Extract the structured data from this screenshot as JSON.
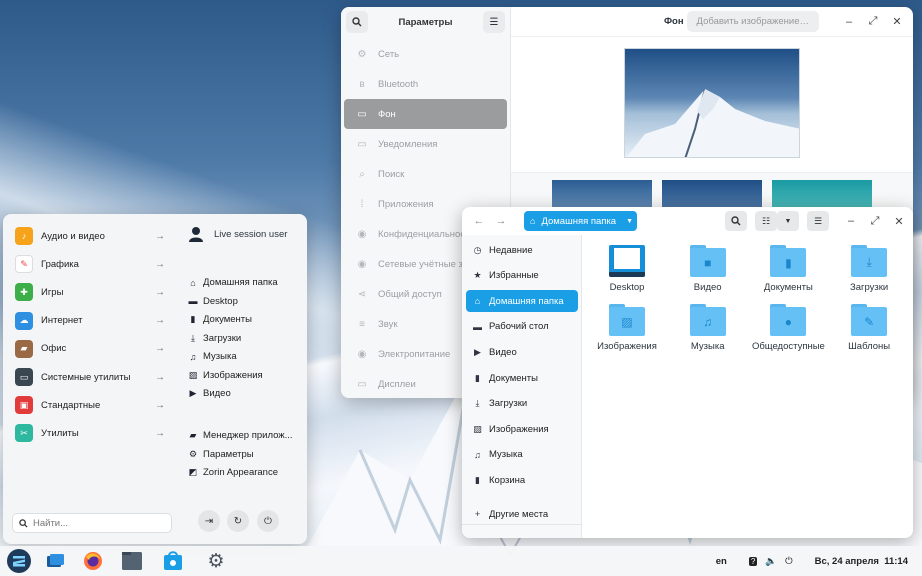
{
  "settings": {
    "title": "Параметры",
    "page_title": "Фон",
    "add_button": "Добавить изображение…",
    "items": [
      {
        "label": "Сеть",
        "icon": "network-icon"
      },
      {
        "label": "Bluetooth",
        "icon": "bluetooth-icon"
      },
      {
        "label": "Фон",
        "icon": "display-icon"
      },
      {
        "label": "Уведомления",
        "icon": "notifications-icon"
      },
      {
        "label": "Поиск",
        "icon": "search-icon"
      },
      {
        "label": "Приложения",
        "icon": "apps-icon"
      },
      {
        "label": "Конфиденциальность",
        "icon": "privacy-icon"
      },
      {
        "label": "Сетевые учётные записи",
        "icon": "accounts-icon"
      },
      {
        "label": "Общий доступ",
        "icon": "share-icon"
      },
      {
        "label": "Звук",
        "icon": "sound-icon"
      },
      {
        "label": "Электропитание",
        "icon": "power-icon"
      },
      {
        "label": "Дисплеи",
        "icon": "display-icon"
      }
    ],
    "active_index": 2
  },
  "menu": {
    "categories": [
      {
        "label": "Аудио и видео",
        "icon": "audio-video-icon",
        "color": "#f6a21a"
      },
      {
        "label": "Графика",
        "icon": "graphics-icon",
        "color": "#ffffff"
      },
      {
        "label": "Игры",
        "icon": "games-icon",
        "color": "#3eae49"
      },
      {
        "label": "Интернет",
        "icon": "internet-icon",
        "color": "#2f8fe0"
      },
      {
        "label": "Офис",
        "icon": "office-icon",
        "color": "#9a6a47"
      },
      {
        "label": "Системные утилиты",
        "icon": "system-icon",
        "color": "#3a4650"
      },
      {
        "label": "Стандартные",
        "icon": "accessories-icon",
        "color": "#e23b3b"
      },
      {
        "label": "Утилиты",
        "icon": "utilities-icon",
        "color": "#2eb8a0"
      }
    ],
    "user": "Live session user",
    "places": [
      {
        "label": "Домашняя папка",
        "icon": "home-icon"
      },
      {
        "label": "Desktop",
        "icon": "desktop-icon"
      },
      {
        "label": "Документы",
        "icon": "documents-icon"
      },
      {
        "label": "Загрузки",
        "icon": "download-icon"
      },
      {
        "label": "Музыка",
        "icon": "music-icon"
      },
      {
        "label": "Изображения",
        "icon": "pictures-icon"
      },
      {
        "label": "Видео",
        "icon": "video-icon"
      }
    ],
    "system": [
      {
        "label": "Менеджер прилож...",
        "icon": "software-icon"
      },
      {
        "label": "Параметры",
        "icon": "settings-icon"
      },
      {
        "label": "Zorin Appearance",
        "icon": "appearance-icon"
      }
    ],
    "search_placeholder": "Найти..."
  },
  "files": {
    "path": "Домашняя папка",
    "sidebar": [
      {
        "label": "Недавние",
        "icon": "recent-icon"
      },
      {
        "label": "Избранные",
        "icon": "star-icon"
      },
      {
        "label": "Домашняя папка",
        "icon": "home-icon"
      },
      {
        "label": "Рабочий стол",
        "icon": "desktop-icon"
      },
      {
        "label": "Видео",
        "icon": "video-icon"
      },
      {
        "label": "Документы",
        "icon": "documents-icon"
      },
      {
        "label": "Загрузки",
        "icon": "download-icon"
      },
      {
        "label": "Изображения",
        "icon": "pictures-icon"
      },
      {
        "label": "Музыка",
        "icon": "music-icon"
      },
      {
        "label": "Корзина",
        "icon": "trash-icon"
      },
      {
        "label": "Другие места",
        "icon": "plus-icon"
      }
    ],
    "active_index": 2,
    "items": [
      {
        "label": "Desktop",
        "icon": "desktop-folder-icon"
      },
      {
        "label": "Видео",
        "icon": "video-folder-icon"
      },
      {
        "label": "Документы",
        "icon": "documents-folder-icon"
      },
      {
        "label": "Загрузки",
        "icon": "download-folder-icon"
      },
      {
        "label": "Изображения",
        "icon": "pictures-folder-icon"
      },
      {
        "label": "Музыка",
        "icon": "music-folder-icon"
      },
      {
        "label": "Общедоступные",
        "icon": "public-folder-icon"
      },
      {
        "label": "Шаблоны",
        "icon": "templates-folder-icon"
      }
    ]
  },
  "taskbar": {
    "lang": "en",
    "datetime": "Вс, 24 апреля  11:14"
  },
  "colors": {
    "accent": "#1a9ee6"
  }
}
